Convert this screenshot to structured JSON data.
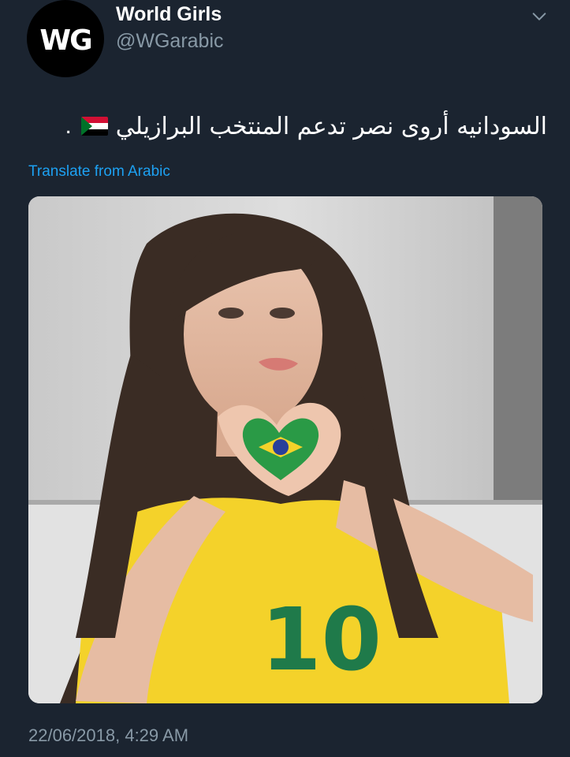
{
  "user": {
    "avatar_text": "WG",
    "display_name": "World Girls",
    "handle": "@WGarabic"
  },
  "tweet": {
    "text": "السودانيه أروى نصر تدعم المنتخب البرازيلي",
    "trailing_punct": ".",
    "flag_icon": "sudan-flag-emoji",
    "translate_label": "Translate from Arabic",
    "timestamp": "22/06/2018, 4:29 AM"
  },
  "media": {
    "description_icon": "photo",
    "jersey_number": "10"
  },
  "colors": {
    "background": "#1b2430",
    "secondary_text": "#8899a6",
    "link": "#1da1f2",
    "jersey_yellow": "#f4d22a",
    "jersey_green": "#1f7a4a"
  }
}
